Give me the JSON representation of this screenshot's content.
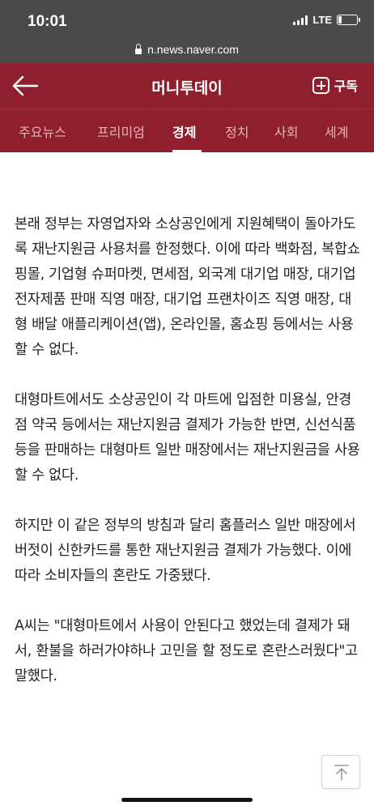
{
  "status_bar": {
    "time": "10:01",
    "network": "LTE",
    "battery_level": 0.2
  },
  "browser": {
    "url": "n.news.naver.com"
  },
  "header": {
    "title": "머니투데이",
    "subscribe_label": "구독"
  },
  "tabs": [
    {
      "label": "주요뉴스",
      "active": false
    },
    {
      "label": "프리미엄",
      "active": false
    },
    {
      "label": "경제",
      "active": true
    },
    {
      "label": "정치",
      "active": false
    },
    {
      "label": "사회",
      "active": false
    },
    {
      "label": "세계",
      "active": false
    }
  ],
  "article": {
    "paragraphs": [
      "본래 정부는 자영업자와 소상공인에게 지원혜택이 돌아가도록 재난지원금 사용처를 한정했다. 이에 따라 백화점, 복합쇼핑몰, 기업형 슈퍼마켓, 면세점, 외국계 대기업 매장, 대기업 전자제품 판매 직영 매장, 대기업 프랜차이즈 직영 매장, 대형 배달 애플리케이션(앱), 온라인몰, 홈쇼핑 등에서는 사용할 수 없다.",
      "대형마트에서도 소상공인이 각 마트에 입점한 미용실, 안경점 약국 등에서는 재난지원금 결제가 가능한 반면, 신선식품 등을 판매하는 대형마트 일반 매장에서는 재난지원금을 사용할 수 없다.",
      "하지만 이 같은 정부의 방침과 달리 홈플러스 일반 매장에서 버젓이 신한카드를 통한 재난지원금 결제가 가능했다. 이에 따라 소비자들의 혼란도 가중됐다.",
      "A씨는 \"대형마트에서 사용이 안된다고 했었는데 결제가 돼서, 환불을 하러가야하나 고민을 할 정도로 혼란스러웠다\"고 말했다."
    ]
  },
  "colors": {
    "brand": "#8f1f2d",
    "status_bar": "#4a4a4a",
    "tab_inactive": "#e3b3b8",
    "text": "#222222"
  }
}
